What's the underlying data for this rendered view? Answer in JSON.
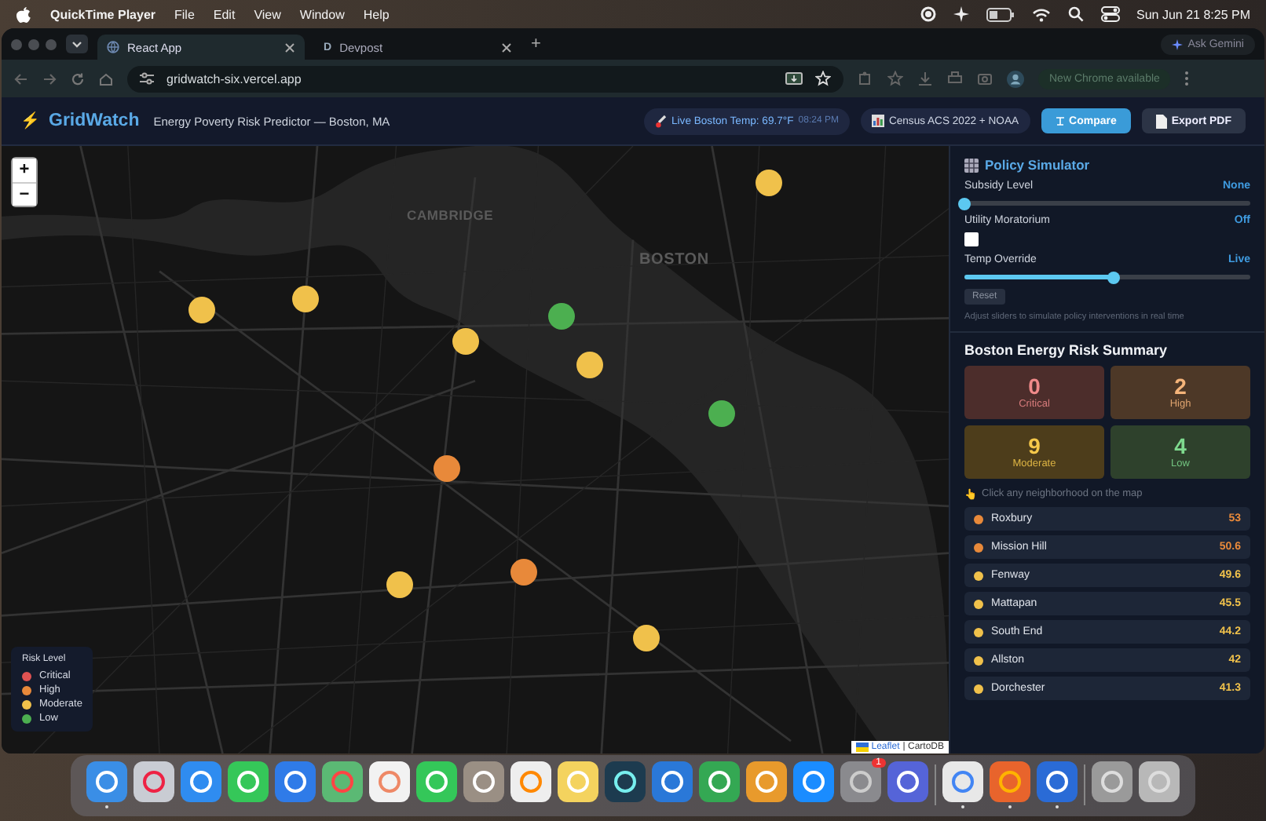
{
  "menubar": {
    "app": "QuickTime Player",
    "menus": [
      "File",
      "Edit",
      "View",
      "Window",
      "Help"
    ],
    "clock": "Sun Jun 21  8:25 PM"
  },
  "browser": {
    "tabs": [
      {
        "title": "React App",
        "selected": true
      },
      {
        "title": "Devpost",
        "selected": false,
        "favicon": "D"
      }
    ],
    "new_tab": "+",
    "gemini": "Ask Gemini",
    "url": "gridwatch-six.vercel.app",
    "update": "New Chrome available"
  },
  "header": {
    "logo_icon": "⚡",
    "logo": "GridWatch",
    "subtitle": "Energy Poverty Risk Predictor — Boston, MA",
    "temp_badge": "Live Boston Temp: 69.7°F",
    "temp_time": "08:24 PM",
    "source_badge": "Census ACS 2022 + NOAA",
    "compare": "Compare",
    "export": "Export PDF"
  },
  "map": {
    "zoom_in": "+",
    "zoom_out": "−",
    "labels": [
      "CAMBRIDGE",
      "BOSTON"
    ],
    "markers": [
      {
        "color": "#f0c14b"
      },
      {
        "color": "#f0c14b"
      },
      {
        "color": "#f0c14b"
      },
      {
        "color": "#4caf50"
      },
      {
        "color": "#f0c14b"
      },
      {
        "color": "#f0c14b"
      },
      {
        "color": "#4caf50"
      },
      {
        "color": "#e8893a"
      },
      {
        "color": "#e8893a"
      },
      {
        "color": "#f0c14b"
      },
      {
        "color": "#f0c14b"
      }
    ],
    "legend": {
      "title": "Risk Level",
      "items": [
        {
          "label": "Critical",
          "color": "#e05252"
        },
        {
          "label": "High",
          "color": "#e8893a"
        },
        {
          "label": "Moderate",
          "color": "#f0c14b"
        },
        {
          "label": "Low",
          "color": "#4caf50"
        }
      ]
    },
    "attribution": {
      "link": "Leaflet",
      "text": "| CartoDB"
    }
  },
  "simulator": {
    "title": "Policy Simulator",
    "controls": [
      {
        "kind": "slider",
        "label": "Subsidy Level",
        "reading": "None",
        "level": 0
      },
      {
        "kind": "checkbox",
        "label": "Utility Moratorium",
        "reading": "Off",
        "checked": false
      },
      {
        "kind": "slider",
        "label": "Temp Override",
        "reading": "Live",
        "level": 0.52
      }
    ],
    "reset": "Reset",
    "note": "Adjust sliders to simulate policy interventions in real time"
  },
  "summary": {
    "title": "Boston Energy Risk Summary",
    "cards": [
      {
        "count": "0",
        "label": "Critical",
        "color": "#f08a8a"
      },
      {
        "count": "2",
        "label": "High",
        "color": "#f5b47a"
      },
      {
        "count": "9",
        "label": "Moderate",
        "color": "#f5c84a"
      },
      {
        "count": "4",
        "label": "Low",
        "color": "#7ed98e"
      }
    ],
    "hint_icon": "👆",
    "hint": "Click any neighborhood on the map",
    "rows": [
      {
        "name": "Roxbury",
        "score": "53",
        "color": "#e8893a"
      },
      {
        "name": "Mission Hill",
        "score": "50.6",
        "color": "#e8893a"
      },
      {
        "name": "Fenway",
        "score": "49.6",
        "color": "#f0c14b"
      },
      {
        "name": "Mattapan",
        "score": "45.5",
        "color": "#f0c14b"
      },
      {
        "name": "South End",
        "score": "44.2",
        "color": "#f0c14b"
      },
      {
        "name": "Allston",
        "score": "42",
        "color": "#f0c14b"
      },
      {
        "name": "Dorchester",
        "score": "41.3",
        "color": "#f0c14b"
      }
    ]
  },
  "dock": {
    "apps": [
      {
        "running": true
      },
      {
        "running": false
      },
      {
        "running": false
      },
      {
        "running": false
      },
      {
        "running": false
      },
      {
        "running": false
      },
      {
        "running": false
      },
      {
        "running": false
      },
      {
        "running": false
      },
      {
        "running": false
      },
      {
        "running": false
      },
      {
        "running": false
      },
      {
        "running": false
      },
      {
        "running": false
      },
      {
        "running": false
      },
      {
        "running": false
      },
      {
        "running": false,
        "badge": "1"
      },
      {
        "running": false
      },
      {
        "running": true
      },
      {
        "running": true
      },
      {
        "running": true
      },
      {
        "running": false
      },
      {
        "running": false
      }
    ]
  }
}
